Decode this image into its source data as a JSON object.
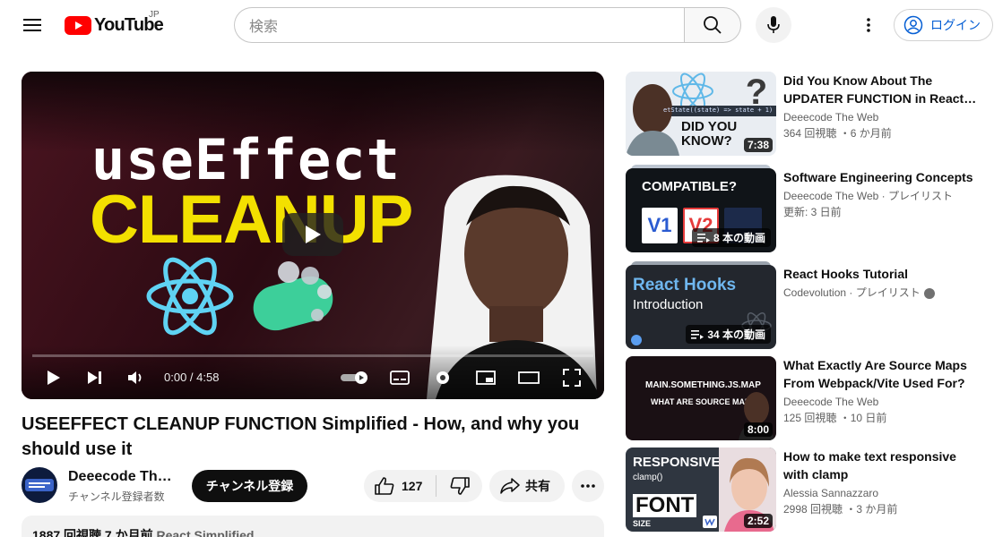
{
  "header": {
    "logo_text": "YouTube",
    "country_code": "JP",
    "search_placeholder": "検索",
    "signin_label": "ログイン"
  },
  "player": {
    "thumb_line1": "useEffect",
    "thumb_line2": "CLEANUP",
    "current_time": "0:00",
    "duration": "4:58",
    "time_display": "0:00 / 4:58",
    "progress": 0.0
  },
  "video": {
    "title": "USEEFFECT CLEANUP FUNCTION Simplified - How, and why you should use it",
    "channel_name": "Deeecode The Web",
    "channel_subs": "チャンネル登録者数",
    "subscribe_label": "チャンネル登録",
    "like_count": "127",
    "share_label": "共有",
    "description_line": "1887 回視聴  7 か月前",
    "description_tag": "React Simplified"
  },
  "recommendations": [
    {
      "title": "Did You Know About The UPDATER FUNCTION in React…",
      "channel": "Deeecode The Web",
      "stats": "364 回視聴 ・6 か月前",
      "duration": "7:38",
      "thumb_text_1": "DID YOU",
      "thumb_text_2": "KNOW?",
      "thumb_code": "etState((state) => state + 1)"
    },
    {
      "title": "Software Engineering Concepts",
      "channel": "Deeecode The Web · プレイリスト",
      "stats": "更新: 3 日前",
      "video_count": "8 本の動画",
      "thumb_text_1": "COMPATIBLE?",
      "thumb_v1": "V1",
      "thumb_v2": "V2"
    },
    {
      "title": "React Hooks Tutorial",
      "channel": "Codevolution · プレイリスト",
      "video_count": "34 本の動画",
      "thumb_text_1": "React Hooks",
      "thumb_text_2": "Introduction"
    },
    {
      "title": "What Exactly Are Source Maps From Webpack/Vite Used For?",
      "channel": "Deeecode The Web",
      "stats": "125 回視聴 ・10 日前",
      "duration": "8:00",
      "thumb_text_1": "MAIN.SOMETHING.JS.MAP",
      "thumb_text_2": "WHAT ARE SOURCE MAPS?"
    },
    {
      "title": "How to make text responsive with clamp",
      "channel": "Alessia Sannazzaro",
      "stats": "2998 回視聴 ・3 か月前",
      "duration": "2:52",
      "thumb_text_1": "RESPONSIVE",
      "thumb_text_2": "clamp()",
      "thumb_text_3": "FONT",
      "thumb_text_4": "SIZE"
    }
  ],
  "colors": {
    "brand_red": "#ff0000",
    "link_blue": "#065fd4",
    "thumb_yellow": "#f3e000"
  }
}
